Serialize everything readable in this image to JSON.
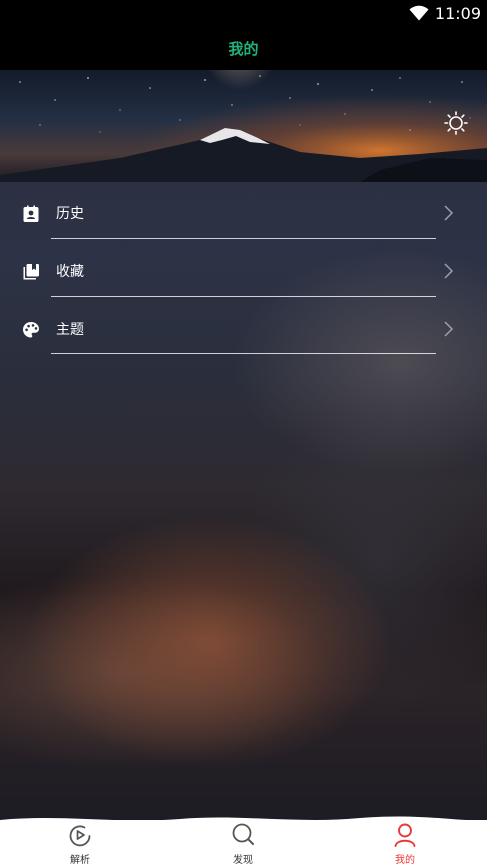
{
  "status_bar": {
    "time": "11:09"
  },
  "header": {
    "title": "我的"
  },
  "menu": {
    "items": [
      {
        "label": "历史",
        "icon": "history-contact-icon"
      },
      {
        "label": "收藏",
        "icon": "favorites-library-icon"
      },
      {
        "label": "主题",
        "icon": "theme-palette-icon"
      }
    ]
  },
  "bottom_nav": {
    "items": [
      {
        "label": "解析",
        "icon": "play-circle-icon",
        "active": false
      },
      {
        "label": "发现",
        "icon": "search-icon",
        "active": false
      },
      {
        "label": "我的",
        "icon": "person-icon",
        "active": true
      }
    ]
  },
  "colors": {
    "title_accent": "#21b27b",
    "nav_active": "#e83a3a",
    "nav_inactive": "#333333"
  }
}
